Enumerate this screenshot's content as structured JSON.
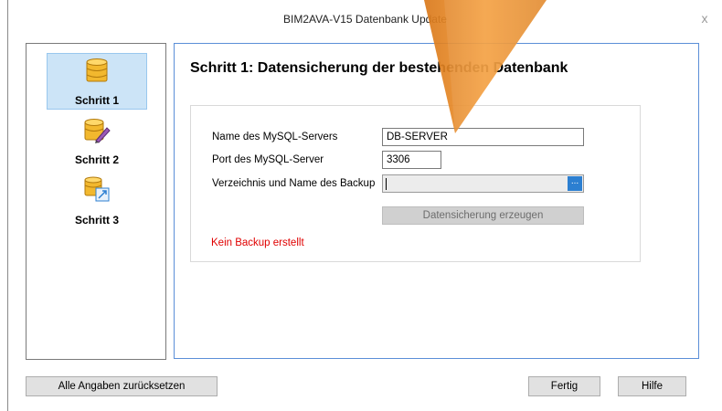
{
  "window": {
    "title": "BIM2AVA-V15 Datenbank Update",
    "close_glyph": "x"
  },
  "steps": [
    {
      "label": "Schritt 1",
      "icon": "database-icon",
      "active": true
    },
    {
      "label": "Schritt 2",
      "icon": "database-edit-icon",
      "active": false
    },
    {
      "label": "Schritt 3",
      "icon": "database-import-icon",
      "active": false
    }
  ],
  "main": {
    "heading": "Schritt 1: Datensicherung der bestehenden Datenbank",
    "server_label": "Name des MySQL-Servers",
    "server_value": "DB-SERVER",
    "port_label": "Port des MySQL-Server",
    "port_value": "3306",
    "backup_label": "Verzeichnis und Name des Backup",
    "backup_value": "",
    "browse_glyph": "...",
    "create_backup_button": "Datensicherung erzeugen",
    "status_text": "Kein Backup erstellt"
  },
  "footer": {
    "reset_button": "Alle Angaben zurücksetzen",
    "finish_button": "Fertig",
    "help_button": "Hilfe"
  },
  "colors": {
    "accent_border": "#5b8fd8",
    "selected_step_bg": "#cce4f7",
    "status_red": "#e00000",
    "overlay_arrow": "#f0952d"
  }
}
